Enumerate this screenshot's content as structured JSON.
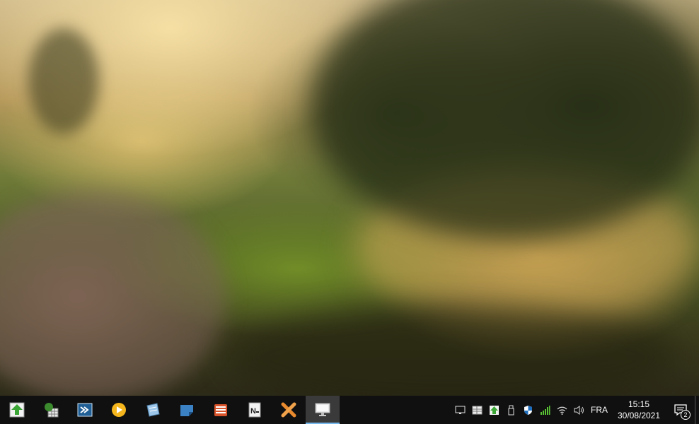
{
  "taskbar": {
    "apps": [
      {
        "icon": "green-up-arrow-icon"
      },
      {
        "icon": "tree-spreadsheet-icon"
      },
      {
        "icon": "terminal-app-icon"
      },
      {
        "icon": "media-player-icon"
      },
      {
        "icon": "notepad-pen-icon"
      },
      {
        "icon": "sticky-note-icon"
      },
      {
        "icon": "stacked-documents-icon"
      },
      {
        "icon": "notepad-n-icon"
      },
      {
        "icon": "tools-cross-icon"
      },
      {
        "icon": "monitor-app-icon",
        "active": true
      }
    ],
    "tray": {
      "icons": [
        "display-tray-icon",
        "grid-tray-icon",
        "update-tray-icon",
        "usb-tray-icon",
        "shield-tray-icon",
        "signal-bars-tray-icon",
        "wifi-tray-icon",
        "volume-tray-icon"
      ],
      "language": "FRA",
      "time": "15:15",
      "date": "30/08/2021",
      "notification_count": "2"
    }
  },
  "colors": {
    "taskbar_bg": "#101010",
    "active_indicator": "#76b9ed"
  }
}
